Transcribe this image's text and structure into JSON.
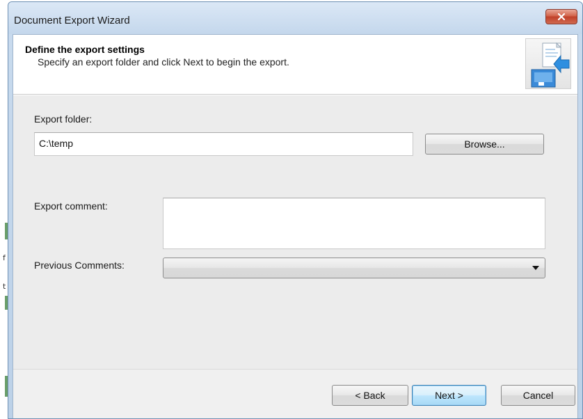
{
  "window": {
    "title": "Document Export Wizard"
  },
  "header": {
    "title": "Define the export settings",
    "subtitle": "Specify an export folder and click Next to begin the export.",
    "icon": "export-wizard-icon"
  },
  "form": {
    "export_folder_label": "Export folder:",
    "export_folder_value": "C:\\temp",
    "browse_label": "Browse...",
    "export_comment_label": "Export comment:",
    "export_comment_value": "",
    "previous_comments_label": "Previous Comments:",
    "previous_comments_value": ""
  },
  "footer": {
    "back_label": "< Back",
    "next_label": "Next >",
    "cancel_label": "Cancel"
  },
  "background": {
    "marks": [
      "f",
      "t"
    ]
  },
  "colors": {
    "title_bar": "#c9dbee",
    "close_button": "#c0402a",
    "default_button_border": "#3c7fb1",
    "body_background": "#ececec"
  }
}
